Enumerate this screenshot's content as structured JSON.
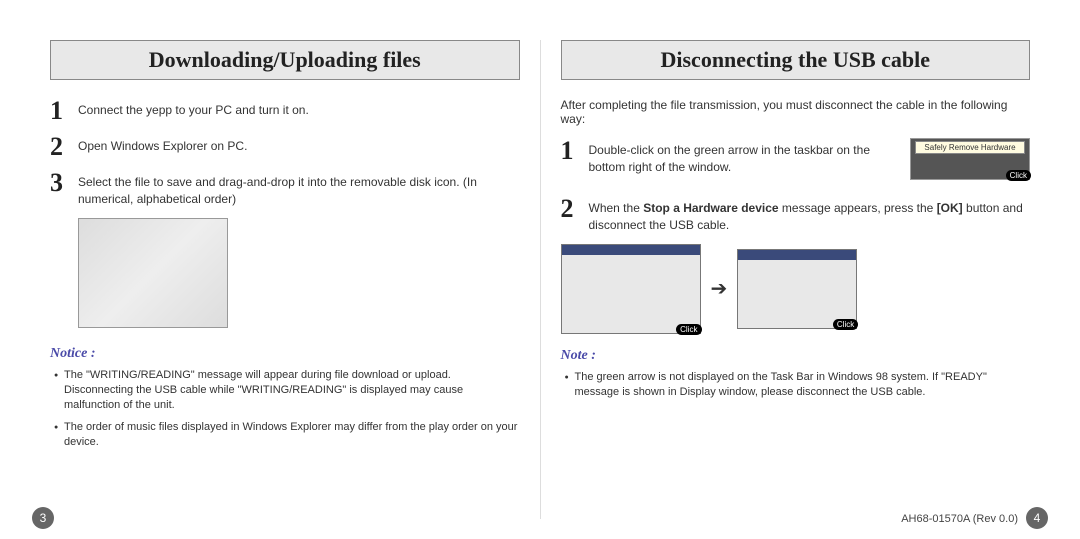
{
  "left": {
    "title": "Downloading/Uploading files",
    "steps": [
      {
        "num": "1",
        "text": "Connect the yepp to your PC and turn it on."
      },
      {
        "num": "2",
        "text": "Open Windows Explorer on PC."
      },
      {
        "num": "3",
        "text": "Select the file to save and drag-and-drop it into the removable disk icon. (In numerical, alphabetical order)"
      }
    ],
    "notice_label": "Notice :",
    "notices": [
      "The \"WRITING/READING\" message will appear during file download or upload. Disconnecting the USB cable while \"WRITING/READING\" is displayed may cause malfunction of the unit.",
      "The order of music files displayed in Windows Explorer may differ from the play order on your device."
    ],
    "page_num": "3"
  },
  "right": {
    "title": "Disconnecting the USB cable",
    "intro": "After completing the file transmission, you must disconnect the cable in the following way:",
    "steps": [
      {
        "num": "1",
        "text": "Double-click on the green arrow in the taskbar on the bottom right of the window."
      },
      {
        "num": "2",
        "text_pre": "When the ",
        "bold1": "Stop a Hardware device",
        "text_mid": " message appears, press the ",
        "bold2": "[OK]",
        "text_post": " button and disconnect the USB cable."
      }
    ],
    "taskbar_tooltip": "Safely Remove Hardware",
    "click_label": "Click",
    "note_label": "Note :",
    "notes": [
      "The green arrow is not displayed on the Task Bar in Windows 98 system. If \"READY\" message is shown in Display window, please disconnect the USB cable."
    ],
    "doc_rev": "AH68-01570A (Rev  0.0)",
    "page_num": "4"
  }
}
